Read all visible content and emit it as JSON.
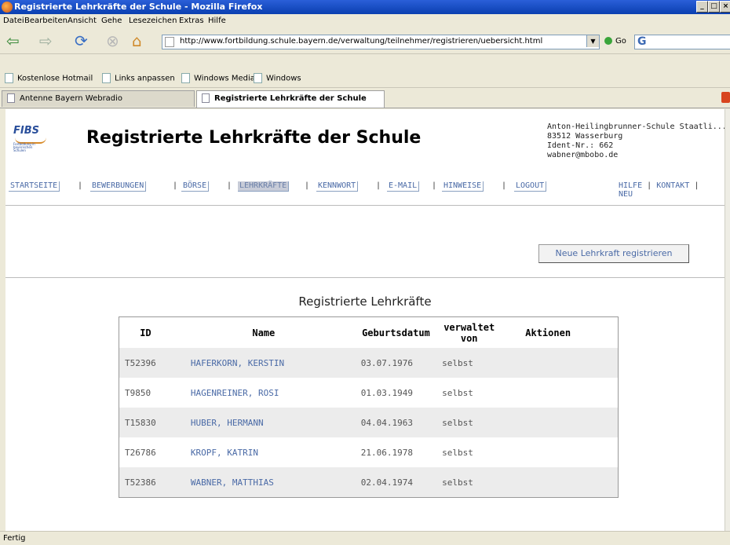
{
  "window": {
    "title": "Registrierte Lehrkräfte der Schule - Mozilla Firefox"
  },
  "menu": [
    "Datei",
    "Bearbeiten",
    "Ansicht",
    "Gehe",
    "Lesezeichen",
    "Extras",
    "Hilfe"
  ],
  "toolbar": {
    "url": "http://www.fortbildung.schule.bayern.de/verwaltung/teilnehmer/registrieren/uebersicht.html",
    "go_label": "Go",
    "search_brand": "G"
  },
  "bookmarks": [
    "Kostenlose Hotmail",
    "Links anpassen",
    "Windows Media",
    "Windows"
  ],
  "tabs": [
    "Antenne Bayern Webradio",
    "Registrierte Lehrkräfte der Schule"
  ],
  "page": {
    "logo_text": "FIBS",
    "logo_subtitle": "Fortbildung in bayerischen Schulen",
    "title": "Registrierte Lehrkräfte der Schule",
    "school": {
      "name": "Anton-Heilingbrunner-Schule Staatli...",
      "city": "83512 Wasserburg",
      "ident": "Ident-Nr.: 662",
      "email": "wabner@mbobo.de"
    }
  },
  "nav": [
    "STARTSEITE",
    "BEWERBUNGEN",
    "BÖRSE",
    "LEHRKRÄFTE",
    "KENNWORT",
    "E-MAIL",
    "HINWEISE",
    "LOGOUT"
  ],
  "help_links": {
    "hilfe": "HILFE",
    "kontakt": "KONTAKT",
    "neu": "NEU",
    "sep": "|"
  },
  "new_button": "Neue Lehrkraft registrieren",
  "table": {
    "title": "Registrierte Lehrkräfte",
    "headers": [
      "ID",
      "Name",
      "Geburtsdatum",
      "verwaltet von",
      "Aktionen"
    ],
    "rows": [
      [
        "T52396",
        "HAFERKORN, KERSTIN",
        "03.07.1976",
        "selbst",
        ""
      ],
      [
        "T9850",
        "HAGENREINER, ROSI",
        "01.03.1949",
        "selbst",
        ""
      ],
      [
        "T15830",
        "HUBER, HERMANN",
        "04.04.1963",
        "selbst",
        ""
      ],
      [
        "T26786",
        "KROPF, KATRIN",
        "21.06.1978",
        "selbst",
        ""
      ],
      [
        "T52386",
        "WABNER, MATTHIAS",
        "02.04.1974",
        "selbst",
        ""
      ]
    ]
  },
  "status": "Fertig"
}
